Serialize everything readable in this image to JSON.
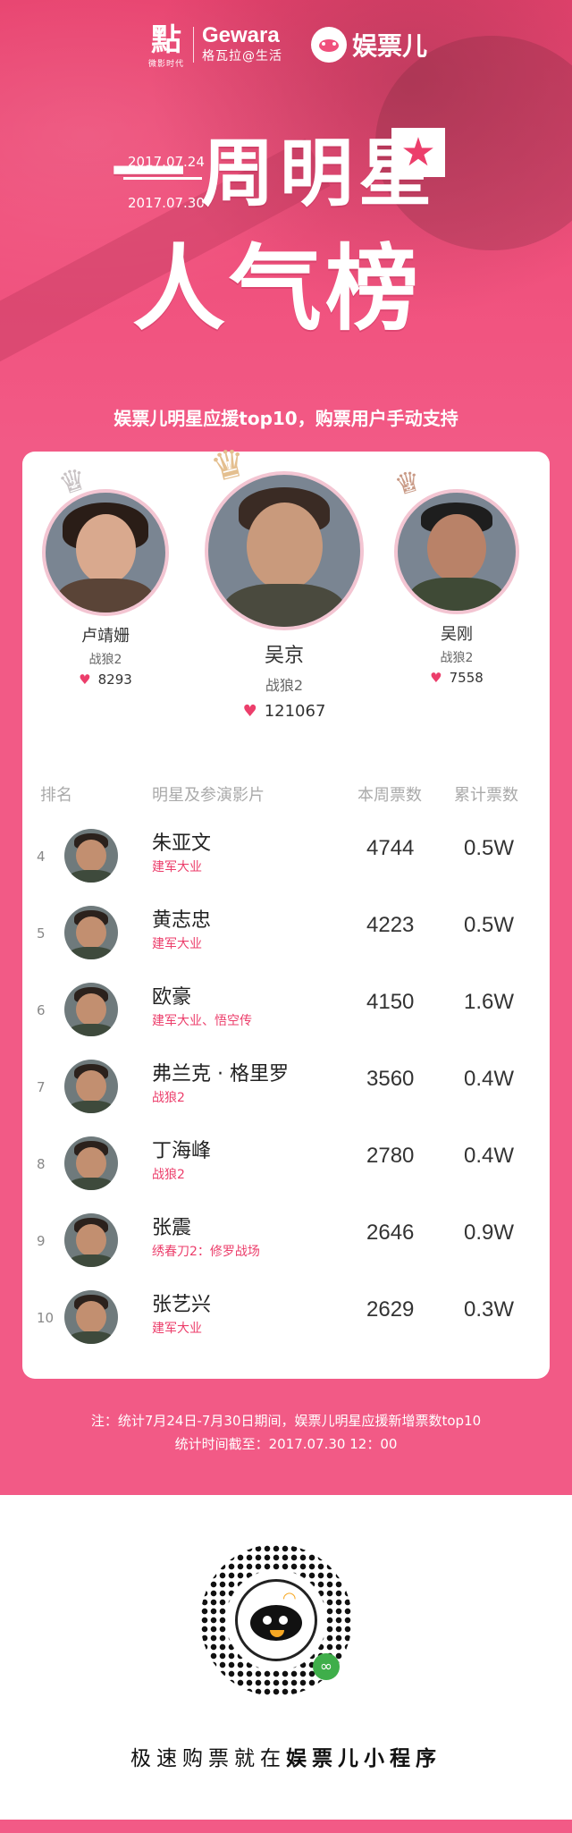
{
  "header": {
    "logo_cube_glyph": "點",
    "logo_cube_sub": "微影时代",
    "logo_gewara_en": "Gewara",
    "logo_gewara_cn": "格瓦拉@生活",
    "logo_ypr": "娱票儿",
    "date_start": "2017.07.24",
    "date_end": "2017.07.30",
    "title_line1": "周明星",
    "title_line1_prefix": "一",
    "title_line2": "人气榜",
    "star_glyph": "★",
    "subtitle": "娱票儿明星应援top10，购票用户手动支持"
  },
  "top3": [
    {
      "rank": "2",
      "name": "卢靖姗",
      "film": "战狼2",
      "votes": "8293"
    },
    {
      "rank": "1",
      "name": "吴京",
      "film": "战狼2",
      "votes": "121067"
    },
    {
      "rank": "3",
      "name": "吴刚",
      "film": "战狼2",
      "votes": "7558"
    }
  ],
  "icons": {
    "heart": "♥",
    "crown": "♛"
  },
  "table": {
    "headers": {
      "rank": "排名",
      "star": "明星及参演影片",
      "week": "本周票数",
      "total": "累计票数"
    },
    "rows": [
      {
        "rank": "4",
        "name": "朱亚文",
        "films": "建军大业",
        "week": "4744",
        "total": "0.5W"
      },
      {
        "rank": "5",
        "name": "黄志忠",
        "films": "建军大业",
        "week": "4223",
        "total": "0.5W"
      },
      {
        "rank": "6",
        "name": "欧豪",
        "films": "建军大业、悟空传",
        "week": "4150",
        "total": "1.6W"
      },
      {
        "rank": "7",
        "name": "弗兰克 · 格里罗",
        "films": "战狼2",
        "week": "3560",
        "total": "0.4W"
      },
      {
        "rank": "8",
        "name": "丁海峰",
        "films": "战狼2",
        "week": "2780",
        "total": "0.4W"
      },
      {
        "rank": "9",
        "name": "张震",
        "films": "绣春刀2：修罗战场",
        "week": "2646",
        "total": "0.9W"
      },
      {
        "rank": "10",
        "name": "张艺兴",
        "films": "建军大业",
        "week": "2629",
        "total": "0.3W"
      }
    ]
  },
  "notes": {
    "line1": "注：统计7月24日-7月30日期间，娱票儿明星应援新增票数top10",
    "line2": "统计时间截至：2017.07.30  12：00"
  },
  "bottom": {
    "cta_prefix": "极速购票就在",
    "cta_bold": "娱票儿小程序",
    "link_glyph": "∞",
    "wifi_glyph": "◠"
  },
  "colors": {
    "accent": "#f25a86",
    "heart": "#ec3e6b",
    "film_text": "#ec3e6b"
  }
}
